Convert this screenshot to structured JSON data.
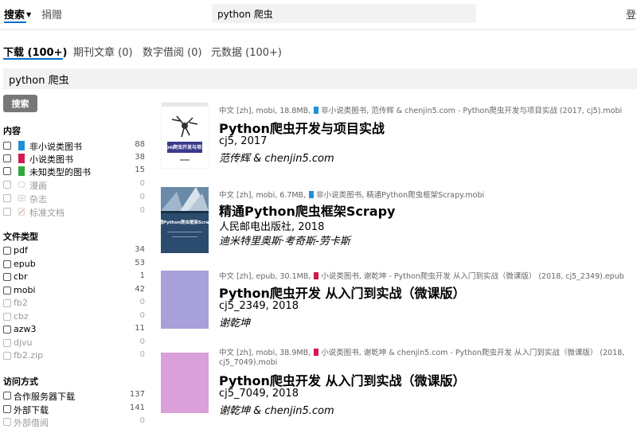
{
  "topbar": {
    "search_tab": "搜索",
    "donate": "捐赠",
    "search_value": "python 爬虫",
    "login": "登"
  },
  "tabs": [
    {
      "label": "下载 (100+)"
    },
    {
      "label": "期刊文章 (0)"
    },
    {
      "label": "数字借阅 (0)"
    },
    {
      "label": "元数据 (100+)"
    }
  ],
  "search": {
    "value": "python 爬虫",
    "button": "搜索"
  },
  "sidebar": {
    "content": {
      "title": "内容",
      "items": [
        {
          "label": "非小说类图书",
          "count": "88",
          "icon": "book-blue-icon",
          "color": "#1f8fd6"
        },
        {
          "label": "小说类图书",
          "count": "38",
          "icon": "book-red-icon",
          "color": "#d01b4f"
        },
        {
          "label": "未知类型的图书",
          "count": "15",
          "icon": "book-green-icon",
          "color": "#2eaa3b"
        },
        {
          "label": "漫画",
          "count": "0",
          "icon": "speech-bubble-icon",
          "color": "#bbbbbb"
        },
        {
          "label": "杂志",
          "count": "0",
          "icon": "newspaper-icon",
          "color": "#bbbbbb"
        },
        {
          "label": "标准文档",
          "count": "0",
          "icon": "document-icon",
          "color": "#bbbbbb"
        }
      ]
    },
    "filetype": {
      "title": "文件类型",
      "items": [
        {
          "label": "pdf",
          "count": "34"
        },
        {
          "label": "epub",
          "count": "53"
        },
        {
          "label": "cbr",
          "count": "1"
        },
        {
          "label": "mobi",
          "count": "42"
        },
        {
          "label": "fb2",
          "count": "0"
        },
        {
          "label": "cbz",
          "count": "0"
        },
        {
          "label": "azw3",
          "count": "11"
        },
        {
          "label": "djvu",
          "count": "0"
        },
        {
          "label": "fb2.zip",
          "count": "0"
        }
      ]
    },
    "access": {
      "title": "访问方式",
      "items": [
        {
          "label": "合作服务器下载",
          "count": "137"
        },
        {
          "label": "外部下载",
          "count": "141"
        },
        {
          "label": "外部借阅",
          "count": "0"
        }
      ]
    }
  },
  "results": [
    {
      "meta_pre": "中文 [zh], mobi, 18.8MB,",
      "meta_post": "非小说类图书, 范传辉 & chenjin5.com - Python爬虫开发与项目实战 (2017, cj5).mobi",
      "tag_color": "#1f8fd6",
      "title": "Python爬虫开发与项目实战",
      "publisher": "cj5, 2017",
      "author": "范传辉 & chenjin5.com",
      "cover_text": "Python爬虫开发与项目实战"
    },
    {
      "meta_pre": "中文 [zh], mobi, 6.7MB,",
      "meta_post": "非小说类图书, 精通Python爬虫框架Scrapy.mobi",
      "tag_color": "#1f8fd6",
      "title": "精通Python爬虫框架Scrapy",
      "publisher": "人民邮电出版社, 2018",
      "author": "迪米特里奥斯·考奇斯-劳卡斯",
      "cover_text": "精通Python爬虫框架Scrapy"
    },
    {
      "meta_pre": "中文 [zh], epub, 30.1MB,",
      "meta_post": "小说类图书, 谢乾坤 - Python爬虫开发 从入门到实战（微课版） (2018, cj5_2349).epub",
      "tag_color": "#d01b4f",
      "title": "Python爬虫开发 从入门到实战（微课版）",
      "publisher": "cj5_2349, 2018",
      "author": "谢乾坤",
      "cover_color": "#a8a0d8"
    },
    {
      "meta_pre": "中文 [zh], mobi, 38.9MB,",
      "meta_post": "小说类图书, 谢乾坤 & chenjin5.com - Python爬虫开发 从入门到实战（微课版） (2018, cj5_7049).mobi",
      "tag_color": "#d01b4f",
      "title": "Python爬虫开发 从入门到实战（微课版）",
      "publisher": "cj5_7049, 2018",
      "author": "谢乾坤 & chenjin5.com",
      "cover_color": "#d9a0d9"
    }
  ]
}
